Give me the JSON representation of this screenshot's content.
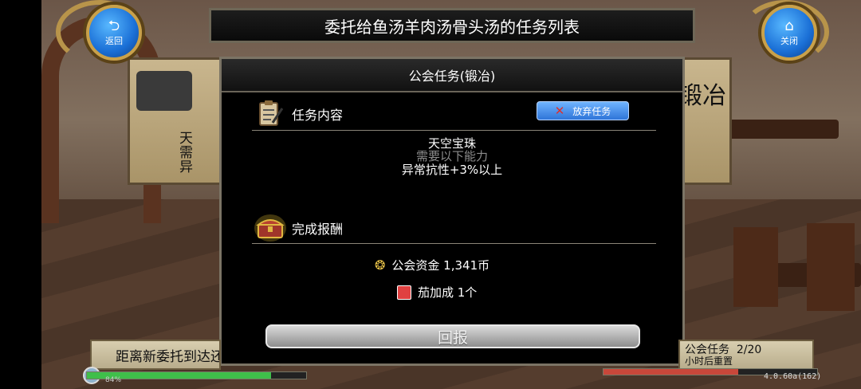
{
  "header": {
    "title": "委托给鱼汤羊肉汤骨头汤的任务列表",
    "back_label": "返回",
    "close_label": "关闭"
  },
  "background_signs": {
    "left_lines": [
      "天",
      "需",
      "异"
    ],
    "right_text": "锻冶"
  },
  "dialog": {
    "title": "公会任务(锻冶)",
    "task_section_label": "任务内容",
    "abandon_label": "放弃任务",
    "task_item": "天空宝珠",
    "requirement_label": "需要以下能力",
    "requirement_value": "异常抗性+3%以上",
    "reward_section_label": "完成报酬",
    "rewards": [
      {
        "icon": "gold-coins-icon",
        "text": "公会资金 1,341币"
      },
      {
        "icon": "item-box-icon",
        "text": "茄加成 1个"
      }
    ],
    "report_label": "回报"
  },
  "footer": {
    "next_commission_text": "距离新委托到达还",
    "guild_task_line": "公会任务  2/20",
    "reset_line": "小时后重置",
    "exp_fraction": 0.84,
    "exp_label": "84%",
    "hp_fraction": 0.63,
    "version": "4.0.60a(162)"
  },
  "colors": {
    "accent_blue": "#2f75d8",
    "gold_frame": "#c9a14a",
    "panel_tan": "#c9b68e"
  }
}
